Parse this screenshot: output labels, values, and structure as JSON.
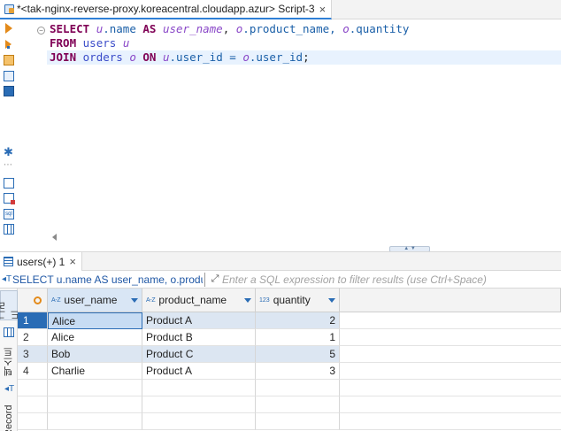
{
  "editor_tab": {
    "title": "*<tak-nginx-reverse-proxy.koreacentral.cloudapp.azur> Script-3",
    "close": "×"
  },
  "sql": {
    "line1": {
      "k1": "SELECT",
      "a1": "u",
      "c1": ".name ",
      "k2": "AS",
      "alias_col": "user_name",
      "p1": ", ",
      "a2": "o",
      "c2": ".product_name, ",
      "a3": "o",
      "c3": ".quantity"
    },
    "line2": {
      "k1": "FROM",
      "t1": "users",
      "a1": "u"
    },
    "line3": {
      "k1": "JOIN",
      "t1": "orders",
      "a1": "o",
      "k2": "ON",
      "a2": "u",
      "c1": ".user_id = ",
      "a3": "o",
      "c2": ".user_id",
      "end": ";"
    }
  },
  "results_tab": {
    "label": "users(+) 1",
    "close": "×"
  },
  "filter": {
    "query": "SELECT u.name AS user_name, o.produ",
    "placeholder": "Enter a SQL expression to filter results (use Ctrl+Space)"
  },
  "side_tabs": {
    "grid": "그리드",
    "text": "텍스트",
    "record": "Record"
  },
  "grid": {
    "columns": [
      {
        "type": "A-Z",
        "label": "user_name"
      },
      {
        "type": "A-Z",
        "label": "product_name"
      },
      {
        "type": "123",
        "label": "quantity"
      }
    ],
    "rows": [
      {
        "num": "1",
        "user_name": "Alice",
        "product_name": "Product A",
        "quantity": "2"
      },
      {
        "num": "2",
        "user_name": "Alice",
        "product_name": "Product B",
        "quantity": "1"
      },
      {
        "num": "3",
        "user_name": "Bob",
        "product_name": "Product C",
        "quantity": "5"
      },
      {
        "num": "4",
        "user_name": "Charlie",
        "product_name": "Product A",
        "quantity": "3"
      }
    ]
  },
  "colors": {
    "keyword": "#7f0055",
    "table": "#3b4cc9",
    "alias": "#8a48c8",
    "accent": "#2a6cb5",
    "row_alt": "#dce6f2"
  },
  "icons": [
    "db-script-icon",
    "run-statement-icon",
    "run-script-icon",
    "open-script-icon",
    "doc-icon",
    "terminal-icon",
    "gear-icon",
    "export-icon",
    "export-error-icon",
    "sql-icon",
    "grid-icon",
    "filter-query-icon",
    "expand-icon",
    "sort-icon"
  ]
}
